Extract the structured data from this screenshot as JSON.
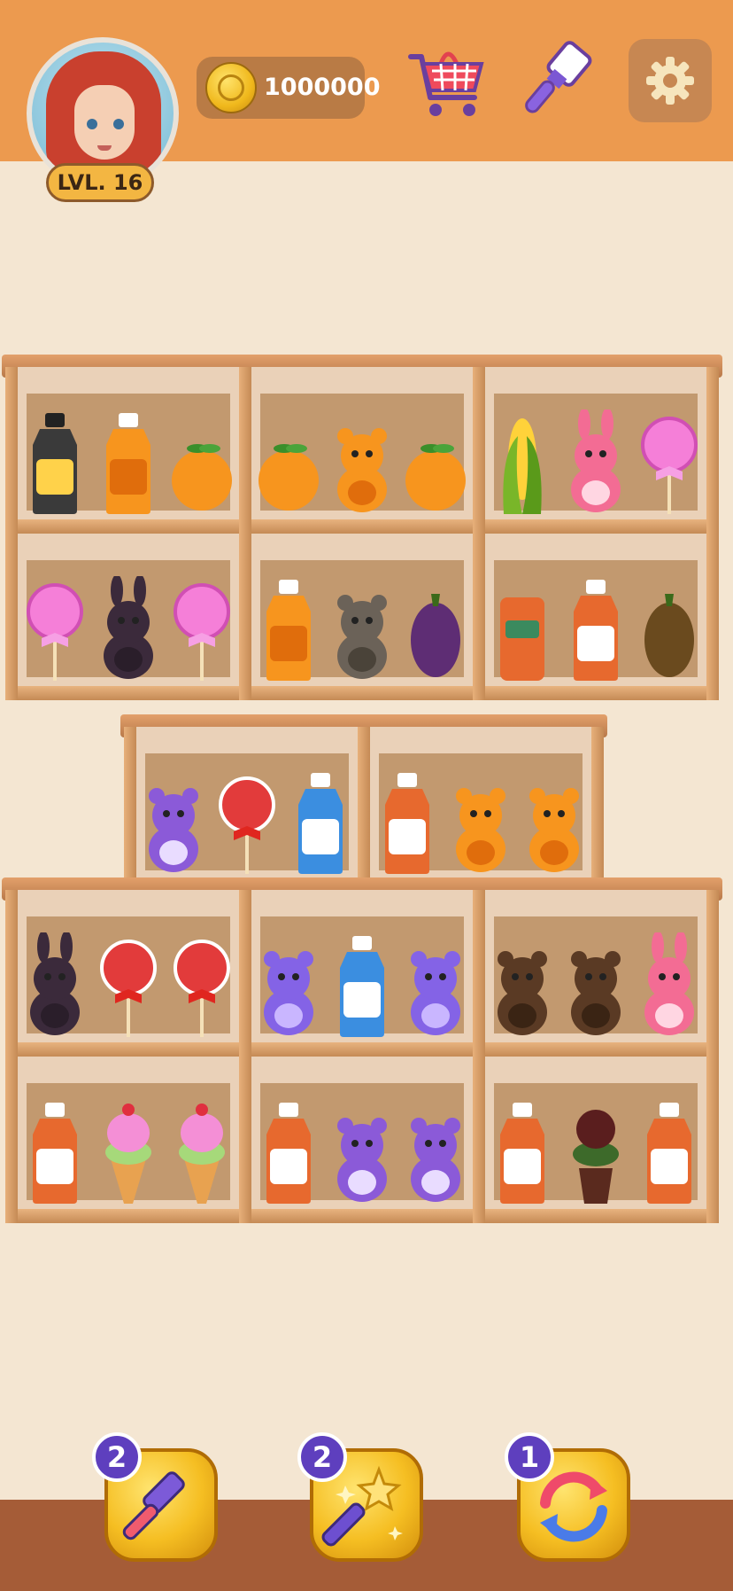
{
  "header": {
    "level_label": "LVL. 16",
    "coins": "1000000",
    "icons": [
      "player-avatar",
      "coin-icon",
      "shopping-cart-icon",
      "paint-brush-icon",
      "gear-icon"
    ]
  },
  "shelves": {
    "upper_unit": {
      "rows": [
        {
          "bays": [
            [
              "black bottle with red bow",
              "orange juice jug with flower",
              "orange"
            ],
            [
              "orange",
              "orange kitten with heart",
              "orange"
            ],
            [
              "corn",
              "pink bunny",
              "pink lollipop doll"
            ]
          ]
        },
        {
          "bays": [
            [
              "pink lollipop doll",
              "dark bunny",
              "pink lollipop doll"
            ],
            [
              "orange juice jug with flower",
              "grey kitten",
              "eggplant"
            ],
            [
              "juice can",
              "peach juice bottle",
              "mango"
            ]
          ]
        }
      ]
    },
    "middle_unit": {
      "bays": [
        [
          "purple dinosaur",
          "lollipop candy",
          "milk bottle"
        ],
        [
          "peach juice bottle",
          "orange kitten with heart",
          "orange kitten with heart"
        ]
      ]
    },
    "lower_unit": {
      "rows": [
        {
          "bays": [
            [
              "dark bunny",
              "lollipop candy",
              "lollipop candy"
            ],
            [
              "purple teddy bear",
              "milk bottle",
              "purple teddy bear"
            ],
            [
              "brown monster",
              "brown monster",
              "pink bunny"
            ]
          ]
        },
        {
          "bays": [
            [
              "grape juice bottle",
              "ice cream cone",
              "ice cream cone"
            ],
            [
              "lemon juice bottle",
              "purple dinosaur",
              "purple dinosaur"
            ],
            [
              "lemon juice bottle",
              "potted rose",
              "peach juice bottle"
            ]
          ]
        }
      ]
    }
  },
  "boosters": [
    {
      "name": "hammer",
      "count": "2"
    },
    {
      "name": "magic-wand",
      "count": "2"
    },
    {
      "name": "shuffle",
      "count": "1"
    }
  ],
  "colors": {
    "header_bg": "#ec9a4f",
    "page_bg": "#f4e6d2",
    "shelf_wood": "#cf9a66",
    "booster_yellow": "#f5be22",
    "badge_purple": "#5e3fbe",
    "floor": "#a55c37"
  }
}
